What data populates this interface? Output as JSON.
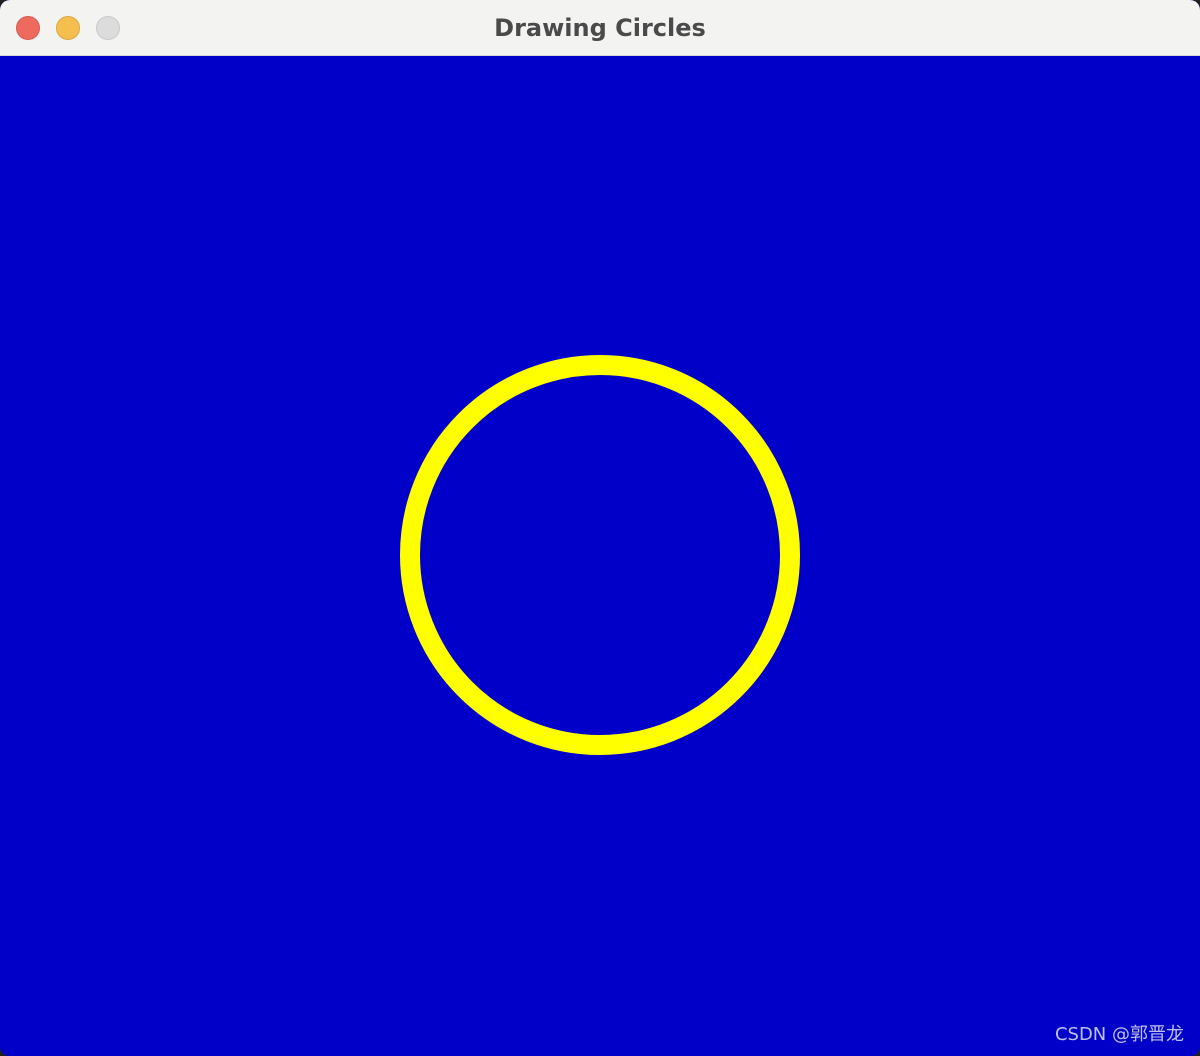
{
  "window": {
    "title": "Drawing Circles",
    "buttons": {
      "close": "close-button",
      "minimize": "minimize-button",
      "maximize": "maximize-button"
    }
  },
  "canvas": {
    "background_color": "#0000c8",
    "shape": "circle",
    "stroke_color": "#ffff00"
  },
  "watermark": {
    "text": "CSDN @郭晋龙"
  }
}
